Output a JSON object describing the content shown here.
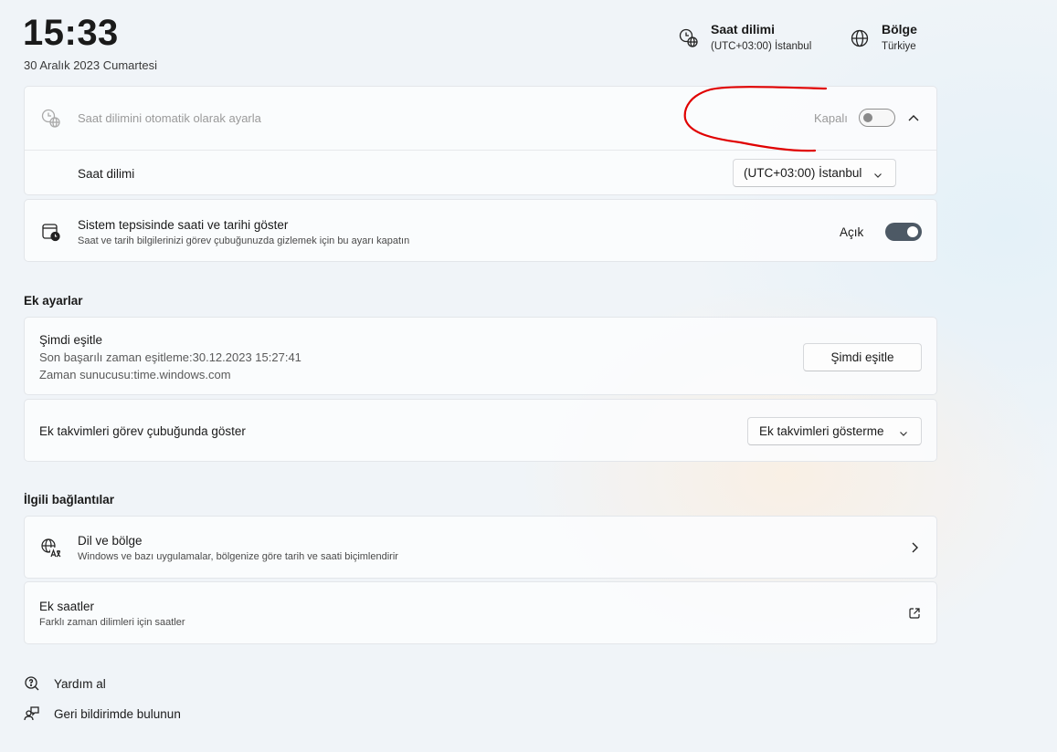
{
  "clock": {
    "time": "15:33",
    "date": "30 Aralık 2023 Cumartesi"
  },
  "header": {
    "timezone": {
      "title": "Saat dilimi",
      "value": "(UTC+03:00) İstanbul",
      "icon": "timezone-clock-globe-icon"
    },
    "region": {
      "title": "Bölge",
      "value": "Türkiye",
      "icon": "globe-icon"
    }
  },
  "auto_timezone": {
    "label": "Saat dilimini otomatik olarak ayarla",
    "state_label": "Kapalı",
    "enabled": false,
    "expanded": true,
    "icon": "timezone-clock-globe-icon"
  },
  "timezone_select": {
    "label": "Saat dilimi",
    "value": "(UTC+03:00) İstanbul"
  },
  "tray": {
    "title": "Sistem tepsisinde saati ve tarihi göster",
    "subtitle": "Saat ve tarih bilgilerinizi görev çubuğunuzda gizlemek için bu ayarı kapatın",
    "state_label": "Açık",
    "enabled": true,
    "icon": "calendar-clock-icon"
  },
  "extra": {
    "section_title": "Ek ayarlar",
    "sync": {
      "title": "Şimdi eşitle",
      "last_sync": "Son başarılı zaman eşitleme:30.12.2023 15:27:41",
      "server": "Zaman sunucusu:time.windows.com",
      "button": "Şimdi eşitle"
    },
    "calendars": {
      "label": "Ek takvimleri görev çubuğunda göster",
      "value": "Ek takvimleri gösterme"
    }
  },
  "related": {
    "section_title": "İlgili bağlantılar",
    "language": {
      "title": "Dil ve bölge",
      "subtitle": "Windows ve bazı uygulamalar, bölgenize göre tarih ve saati biçimlendirir",
      "icon": "language-region-icon"
    },
    "clocks": {
      "title": "Ek saatler",
      "subtitle": "Farklı zaman dilimleri için saatler",
      "icon": "open-external-icon"
    }
  },
  "footer": {
    "help": "Yardım al",
    "feedback": "Geri bildirimde bulunun"
  },
  "colors": {
    "annotation": "#e00000",
    "toggle_on": "#4d5965",
    "background": "#f0f4f8"
  }
}
